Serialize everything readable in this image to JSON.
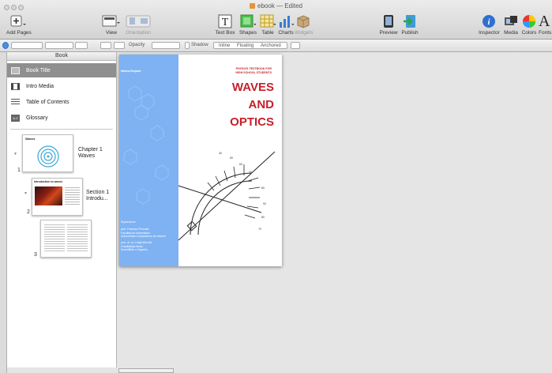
{
  "window": {
    "title": "ebook",
    "edited": "— Edited"
  },
  "toolbar": {
    "add_pages": "Add Pages",
    "view": "View",
    "orientation": "Orientation",
    "text_box": "Text Box",
    "shapes": "Shapes",
    "table": "Table",
    "charts": "Charts",
    "widgets": "Widgets",
    "preview": "Preview",
    "publish": "Publish",
    "inspector": "Inspector",
    "media": "Media",
    "colors": "Colors",
    "fonts": "Fonts"
  },
  "formatbar": {
    "opacity_label": "Opacity",
    "shadow_label": "Shadow",
    "wrap_inline": "Inline",
    "wrap_floating": "Floating",
    "wrap_anchored": "Anchored"
  },
  "sidebar": {
    "header": "Book",
    "items": [
      {
        "label": "Book Title",
        "icon": "book-title-icon",
        "selected": true
      },
      {
        "label": "Intro Media",
        "icon": "film-icon",
        "selected": false
      },
      {
        "label": "Table of Contents",
        "icon": "list-icon",
        "selected": false
      },
      {
        "label": "Glossary",
        "icon": "glossary-icon",
        "selected": false
      }
    ],
    "chapters": [
      {
        "page": "1",
        "thumb_title": "Waves",
        "label_line1": "Chapter 1",
        "label_line2": "Waves"
      },
      {
        "page": "2",
        "thumb_title": "Introduction to waves",
        "label_line1": "Section 1",
        "label_line2": "Introdu..."
      },
      {
        "page": "3"
      }
    ],
    "glossary_icon_text": "A-Z"
  },
  "cover": {
    "author": "Marina Bezjack",
    "subtitle_line1": "PHYSICS TEXTBOOK FOR",
    "subtitle_line2": "HIGH SCHOOL STUDENTS",
    "title_line1": "WAVES",
    "title_line2": "AND",
    "title_line3": "OPTICS",
    "supervisors_label": "Supervisors",
    "sup1_line1": "prof. Federica Pernstel",
    "sup1_line2": "Facultad de Informática",
    "sup1_line3": "Universidad Complutense de Madrid",
    "sup2_line1": "prof. dr. sc. Lidija Marušić",
    "sup2_line2": "Graditeljska škola",
    "sup2_line3": "Sveučilište u Zagrebu"
  },
  "colors": {
    "cover_blue": "#7fb2f2",
    "title_red": "#c8202a",
    "selection_gray": "#8f8f8f"
  }
}
